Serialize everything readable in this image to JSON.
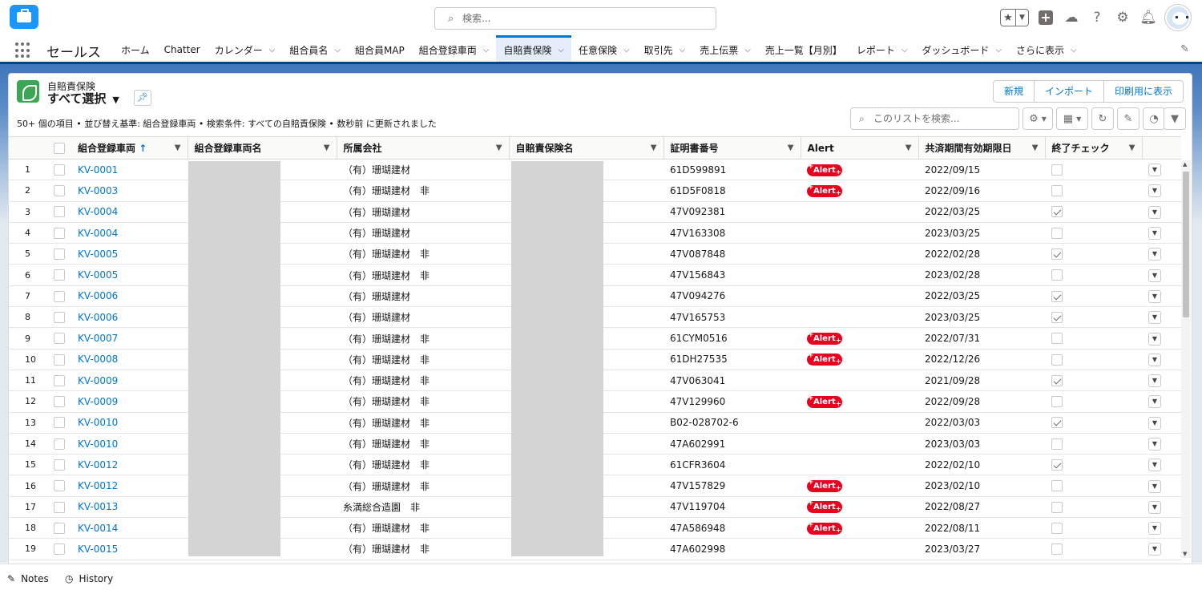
{
  "header": {
    "search_placeholder": "検索...",
    "icons": [
      "star-icon",
      "chevron-down-icon",
      "add-icon",
      "cloud-icon",
      "help-icon",
      "setup-gear-icon",
      "notification-bell-icon",
      "user-avatar"
    ]
  },
  "nav": {
    "app_name": "セールス",
    "items": [
      {
        "label": "ホーム",
        "dropdown": false
      },
      {
        "label": "Chatter",
        "dropdown": false
      },
      {
        "label": "カレンダー",
        "dropdown": true
      },
      {
        "label": "組合員名",
        "dropdown": true
      },
      {
        "label": "組合員MAP",
        "dropdown": false
      },
      {
        "label": "組合登録車両",
        "dropdown": true
      },
      {
        "label": "自賠責保険",
        "dropdown": true,
        "active": true
      },
      {
        "label": "任意保険",
        "dropdown": true
      },
      {
        "label": "取引先",
        "dropdown": true
      },
      {
        "label": "売上伝票",
        "dropdown": true
      },
      {
        "label": "売上一覧【月別】",
        "dropdown": false
      },
      {
        "label": "レポート",
        "dropdown": true
      },
      {
        "label": "ダッシュボード",
        "dropdown": true
      },
      {
        "label": "さらに表示",
        "dropdown": true
      }
    ]
  },
  "list": {
    "object_label": "自賠責保険",
    "view_name": "すべて選択",
    "meta": "50+ 個の項目 • 並び替え基準: 組合登録車両 • 検索条件: すべての自賠責保険 • 数秒前 に更新されました",
    "buttons": [
      "新規",
      "インポート",
      "印刷用に表示"
    ],
    "search_placeholder": "このリストを検索...",
    "columns": [
      "組合登録車両",
      "組合登録車両名",
      "所属会社",
      "自賠責保険名",
      "証明書番号",
      "Alert",
      "共済期間有効期限日",
      "終了チェック"
    ],
    "sort_indicator": "↑",
    "alert_label": "Alert",
    "rows": [
      {
        "n": "1",
        "vehicle": "KV-0001",
        "company": "（有）珊瑚建材",
        "cert": "61D599891",
        "alert": true,
        "expiry": "2022/09/15",
        "done": false
      },
      {
        "n": "2",
        "vehicle": "KV-0003",
        "company": "（有）珊瑚建材　非",
        "cert": "61D5F0818",
        "alert": true,
        "expiry": "2022/09/16",
        "done": false
      },
      {
        "n": "3",
        "vehicle": "KV-0004",
        "company": "（有）珊瑚建材",
        "cert": "47V092381",
        "alert": false,
        "expiry": "2022/03/25",
        "done": true
      },
      {
        "n": "4",
        "vehicle": "KV-0004",
        "company": "（有）珊瑚建材",
        "cert": "47V163308",
        "alert": false,
        "expiry": "2023/03/25",
        "done": false
      },
      {
        "n": "5",
        "vehicle": "KV-0005",
        "company": "（有）珊瑚建材　非",
        "cert": "47V087848",
        "alert": false,
        "expiry": "2022/02/28",
        "done": true
      },
      {
        "n": "6",
        "vehicle": "KV-0005",
        "company": "（有）珊瑚建材　非",
        "cert": "47V156843",
        "alert": false,
        "expiry": "2023/02/28",
        "done": false
      },
      {
        "n": "7",
        "vehicle": "KV-0006",
        "company": "（有）珊瑚建材",
        "cert": "47V094276",
        "alert": false,
        "expiry": "2022/03/25",
        "done": true
      },
      {
        "n": "8",
        "vehicle": "KV-0006",
        "company": "（有）珊瑚建材",
        "cert": "47V165753",
        "alert": false,
        "expiry": "2023/03/25",
        "done": true
      },
      {
        "n": "9",
        "vehicle": "KV-0007",
        "company": "（有）珊瑚建材　非",
        "cert": "61CYM0516",
        "alert": true,
        "expiry": "2022/07/31",
        "done": false
      },
      {
        "n": "10",
        "vehicle": "KV-0008",
        "company": "（有）珊瑚建材　非",
        "cert": "61DH27535",
        "alert": true,
        "expiry": "2022/12/26",
        "done": false
      },
      {
        "n": "11",
        "vehicle": "KV-0009",
        "company": "（有）珊瑚建材　非",
        "cert": "47V063041",
        "alert": false,
        "expiry": "2021/09/28",
        "done": true
      },
      {
        "n": "12",
        "vehicle": "KV-0009",
        "company": "（有）珊瑚建材　非",
        "cert": "47V129960",
        "alert": true,
        "expiry": "2022/09/28",
        "done": false
      },
      {
        "n": "13",
        "vehicle": "KV-0010",
        "company": "（有）珊瑚建材　非",
        "cert": "B02-028702-6",
        "alert": false,
        "expiry": "2022/03/03",
        "done": true
      },
      {
        "n": "14",
        "vehicle": "KV-0010",
        "company": "（有）珊瑚建材　非",
        "cert": "47A602991",
        "alert": false,
        "expiry": "2023/03/03",
        "done": false
      },
      {
        "n": "15",
        "vehicle": "KV-0012",
        "company": "（有）珊瑚建材　非",
        "cert": "61CFR3604",
        "alert": false,
        "expiry": "2022/02/10",
        "done": true
      },
      {
        "n": "16",
        "vehicle": "KV-0012",
        "company": "（有）珊瑚建材　非",
        "cert": "47V157829",
        "alert": true,
        "expiry": "2023/02/10",
        "done": false
      },
      {
        "n": "17",
        "vehicle": "KV-0013",
        "company": "糸満総合造園　非",
        "cert": "47V119704",
        "alert": true,
        "expiry": "2022/08/27",
        "done": false
      },
      {
        "n": "18",
        "vehicle": "KV-0014",
        "company": "（有）珊瑚建材　非",
        "cert": "47A586948",
        "alert": true,
        "expiry": "2022/08/11",
        "done": false
      },
      {
        "n": "19",
        "vehicle": "KV-0015",
        "company": "（有）珊瑚建材　非",
        "cert": "47A602998",
        "alert": false,
        "expiry": "2023/03/27",
        "done": false
      }
    ]
  },
  "utility": {
    "notes": "Notes",
    "history": "History"
  }
}
